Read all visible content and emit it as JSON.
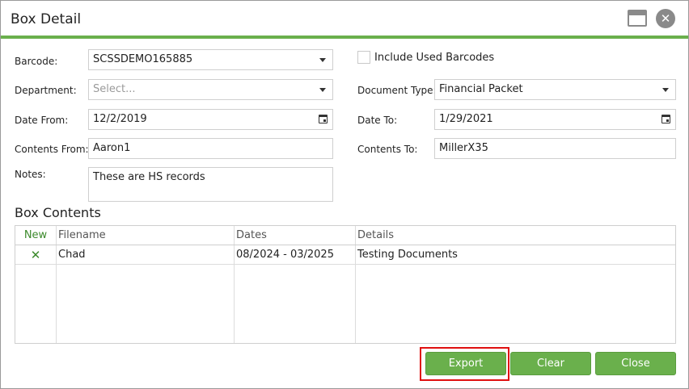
{
  "dialog": {
    "title": "Box Detail",
    "maximize_icon": "window-maximize-icon",
    "close_icon": "close-icon",
    "close_glyph": "✕"
  },
  "form": {
    "barcode_label": "Barcode:",
    "barcode_value": "SCSSDEMO165885",
    "include_used_label": "Include Used Barcodes",
    "include_used_checked": false,
    "department_label": "Department:",
    "department_placeholder": "Select...",
    "document_type_label": "Document Type:",
    "document_type_value": "Financial Packet",
    "date_from_label": "Date From:",
    "date_from_value": "12/2/2019",
    "date_to_label": "Date To:",
    "date_to_value": "1/29/2021",
    "contents_from_label": "Contents From:",
    "contents_from_value": "Aaron1",
    "contents_to_label": "Contents To:",
    "contents_to_value": "MillerX35",
    "notes_label": "Notes:",
    "notes_value": "These are HS records"
  },
  "box_contents": {
    "title": "Box Contents",
    "headers": {
      "new": "New",
      "filename": "Filename",
      "dates": "Dates",
      "details": "Details"
    },
    "rows": [
      {
        "delete_glyph": "✕",
        "filename": "Chad",
        "dates": "08/2024 - 03/2025",
        "details": "Testing Documents"
      }
    ]
  },
  "buttons": {
    "export": "Export",
    "clear": "Clear",
    "close": "Close"
  },
  "colors": {
    "accent": "#6ab04c",
    "highlight": "#e01010"
  }
}
